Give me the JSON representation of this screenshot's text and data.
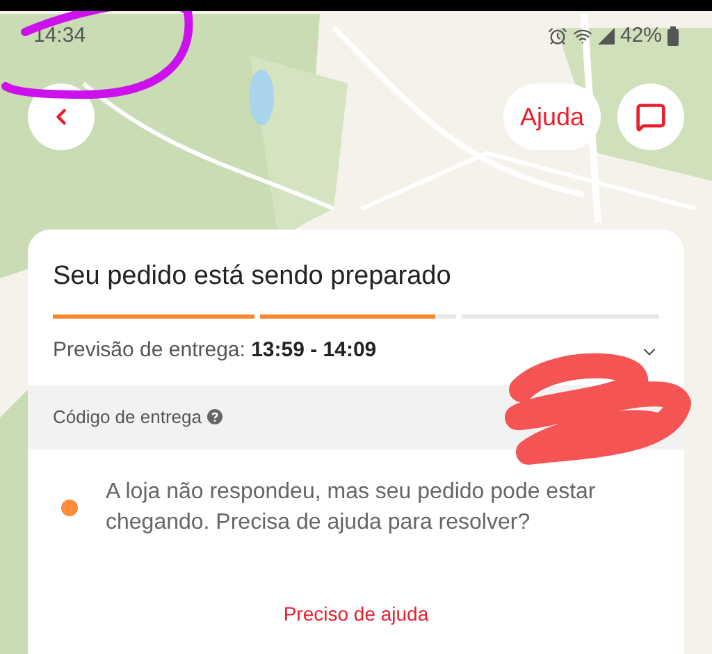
{
  "status_bar": {
    "time": "14:34",
    "battery": "42%"
  },
  "top_buttons": {
    "help": "Ajuda"
  },
  "card": {
    "title": "Seu pedido está sendo preparado",
    "progress": {
      "level": 0.63
    },
    "eta": {
      "label": "Previsão de entrega:",
      "time": "13:59 - 14:09",
      "expanded": false
    },
    "delivery_code": {
      "label": "Código de entrega"
    },
    "notice": {
      "text": "A loja não respondeu, mas seu pedido pode estar chegando. Precisa de ajuda para resolver?",
      "color": "#ff8c3a"
    },
    "help_link": "Preciso de ajuda"
  }
}
